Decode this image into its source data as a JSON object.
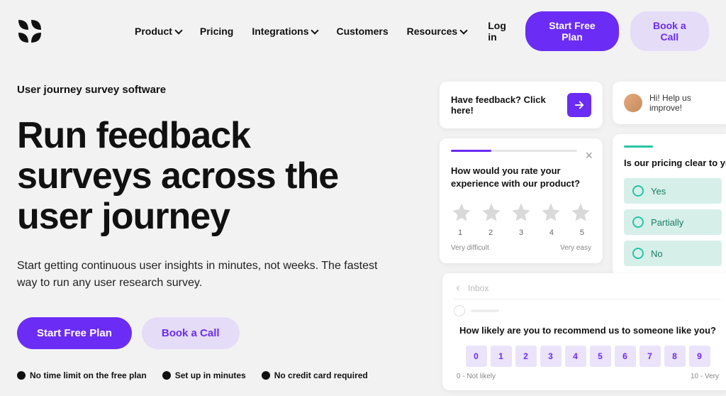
{
  "nav": {
    "items": [
      {
        "label": "Product",
        "dropdown": true
      },
      {
        "label": "Pricing",
        "dropdown": false
      },
      {
        "label": "Integrations",
        "dropdown": true
      },
      {
        "label": "Customers",
        "dropdown": false
      },
      {
        "label": "Resources",
        "dropdown": true
      }
    ],
    "login": "Log in",
    "cta_primary": "Start Free Plan",
    "cta_secondary": "Book a Call"
  },
  "hero": {
    "eyebrow": "User journey survey software",
    "headline": "Run feedback surveys across the user journey",
    "subhead": "Start getting continuous user insights in minutes, not weeks. The fastest way to run any user research survey.",
    "cta_primary": "Start Free Plan",
    "cta_secondary": "Book a Call",
    "features": [
      "No time limit on the free plan",
      "Set up in minutes",
      "No credit card required"
    ]
  },
  "widgets": {
    "feedback": {
      "text": "Have feedback? Click here!"
    },
    "rating": {
      "question": "How would you rate your experience with our product?",
      "nums": [
        "1",
        "2",
        "3",
        "4",
        "5"
      ],
      "low": "Very difficult",
      "high": "Very easy"
    },
    "help": {
      "text": "Hi! Help us improve!"
    },
    "pricing": {
      "question": "Is our pricing clear to you",
      "options": [
        "Yes",
        "Partially",
        "No"
      ]
    },
    "nps": {
      "inbox": "Inbox",
      "question": "How likely are you to recommend us to someone like you?",
      "scale": [
        "0",
        "1",
        "2",
        "3",
        "4",
        "5",
        "6",
        "7",
        "8",
        "9"
      ],
      "low": "0 - Not likely",
      "high": "10 - Very"
    }
  }
}
